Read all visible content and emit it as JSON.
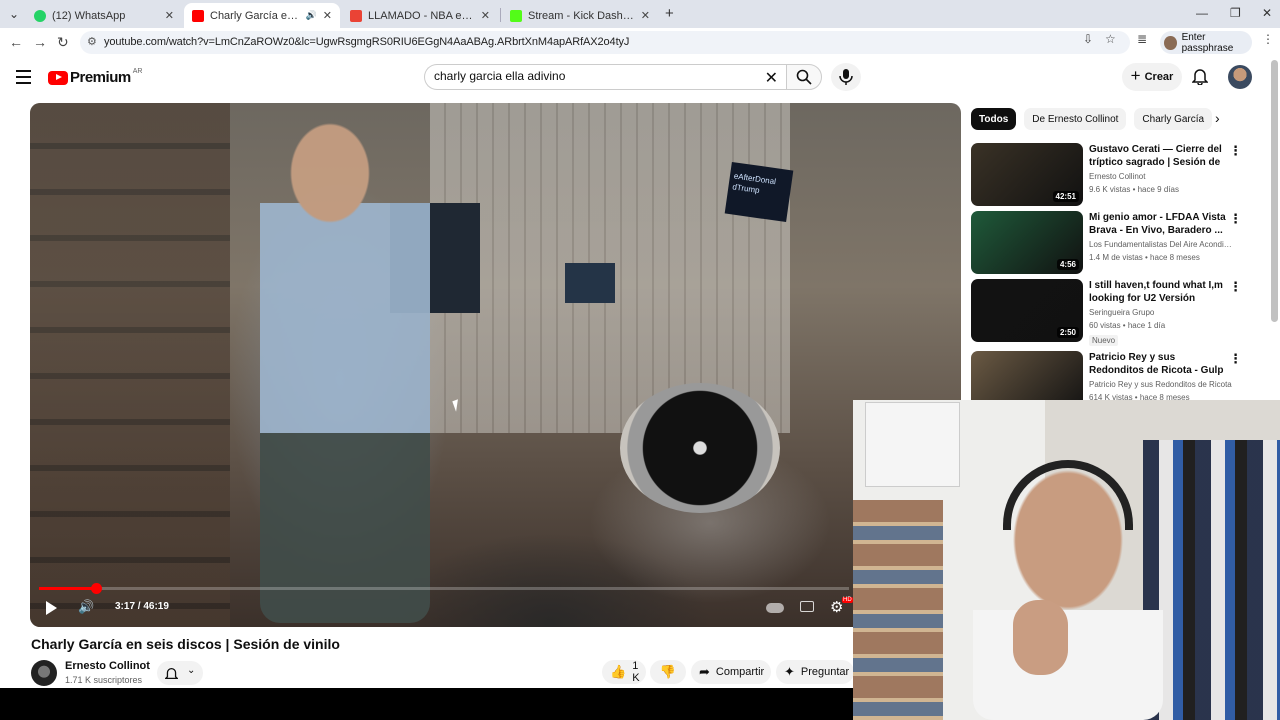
{
  "browser": {
    "tabs": [
      {
        "title": "(12) WhatsApp"
      },
      {
        "title": "Charly García en seis discos"
      },
      {
        "title": "LLAMADO - NBA en Prime, JAI"
      },
      {
        "title": "Stream - Kick Dashboard"
      }
    ],
    "url": "youtube.com/watch?v=LmCnZaROWz0&lc=UgwRsgmgRS0RIU6EGgN4AaABAg.ARbrtXnM4apARfAX2o4tyJ",
    "passphrase_button": "Enter passphrase"
  },
  "youtube": {
    "logo_text": "Premium",
    "country_code": "AR",
    "search_value": "charly garcia ella adivino",
    "create_label": "Crear"
  },
  "player": {
    "time": "3:17 / 46:19",
    "progress_fraction": 0.0709,
    "sign_text": "eAfterDonal dTrump",
    "hd_badge": "HD"
  },
  "video": {
    "title": "Charly García en seis discos | Sesión de vinilo",
    "channel": "Ernesto Collinot",
    "subscribers": "1.71 K suscriptores",
    "likes": "1 K",
    "share_label": "Compartir",
    "ask_label": "Preguntar"
  },
  "sidebar": {
    "chips": [
      "Todos",
      "De Ernesto Collinot",
      "Charly García"
    ],
    "recommendations": [
      {
        "title": "Gustavo Cerati — Cierre del tríptico sagrado | Sesión de ...",
        "channel": "Ernesto Collinot",
        "meta": "9.6 K vistas • hace 9 días",
        "duration": "42:51",
        "badge": "",
        "thumb_color": "#3a3226"
      },
      {
        "title": "Mi genio amor - LFDAA  Vista Brava  - En Vivo, Baradero ...",
        "channel": "Los Fundamentalistas Del Aire Acondici...",
        "meta": "1.4 M de vistas • hace 8 meses",
        "duration": "4:56",
        "badge": "",
        "thumb_color": "#1f5a3a"
      },
      {
        "title": "I still haven,t found what I,m looking for U2 Versión",
        "channel": "Seringueira Grupo",
        "meta": "60 vistas • hace 1 día",
        "duration": "2:50",
        "badge": "Nuevo",
        "thumb_color": "#121212"
      },
      {
        "title": "Patricio Rey y sus Redonditos de Ricota - Gulp en vinilo ...",
        "channel": "Patricio Rey y sus Redonditos de Ricota",
        "meta": "614 K vistas • hace 8 meses",
        "duration": "",
        "badge": "",
        "thumb_color": "#6b5a44"
      }
    ]
  }
}
